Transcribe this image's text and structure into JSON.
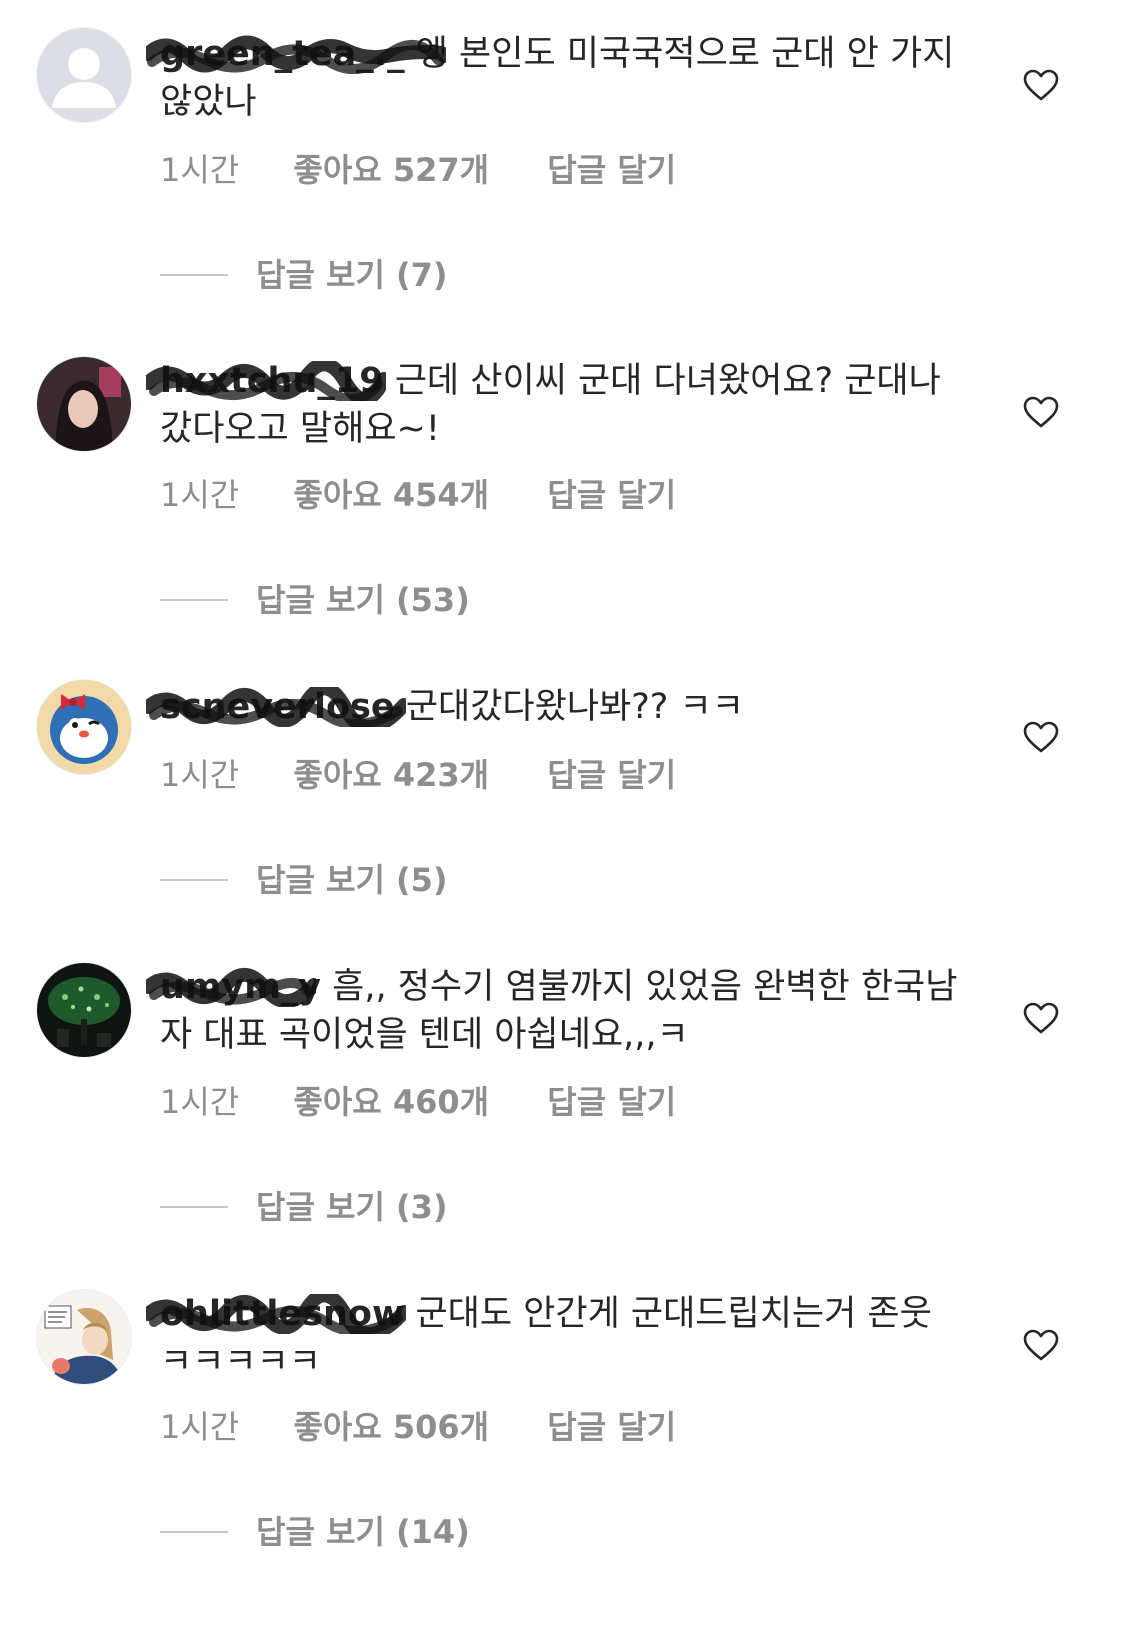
{
  "comments": [
    {
      "username": "green_tea_._",
      "text": "엥 본인도 미국국적으로 군대 안 가지 않았나",
      "time": "1시간",
      "likes": "좋아요 527개",
      "reply": "답글 달기",
      "view_replies": "답글 보기 (7)"
    },
    {
      "username": "hxxtchu_19",
      "text": "근데 산이씨 군대 다녀왔어요? 군대나 갔다오고 말해요~!",
      "time": "1시간",
      "likes": "좋아요 454개",
      "reply": "답글 달기",
      "view_replies": "답글 보기 (53)"
    },
    {
      "username": "scneverlose",
      "text": "군대갔다왔나봐?? ㅋㅋ",
      "time": "1시간",
      "likes": "좋아요 423개",
      "reply": "답글 달기",
      "view_replies": "답글 보기 (5)"
    },
    {
      "username": "umym_y",
      "text": "흠,, 정수기 염불까지 있었음 완벽한 한국남자 대표 곡이었을 텐데 아쉽네요,,,ㅋ",
      "time": "1시간",
      "likes": "좋아요 460개",
      "reply": "답글 달기",
      "view_replies": "답글 보기 (3)"
    },
    {
      "username": "ohlittlesnow",
      "text": "군대도 안간게 군대드립치는거 존웃ㅋㅋㅋㅋㅋ",
      "time": "1시간",
      "likes": "좋아요 506개",
      "reply": "답글 달기",
      "view_replies": "답글 보기 (14)"
    }
  ],
  "icons": {
    "like": "heart-outline-icon",
    "avatar_default": "default-user-icon"
  },
  "colors": {
    "text": "#262626",
    "secondary": "#8e8e8e",
    "divider": "#c7c7c7",
    "redaction": "#111111"
  }
}
